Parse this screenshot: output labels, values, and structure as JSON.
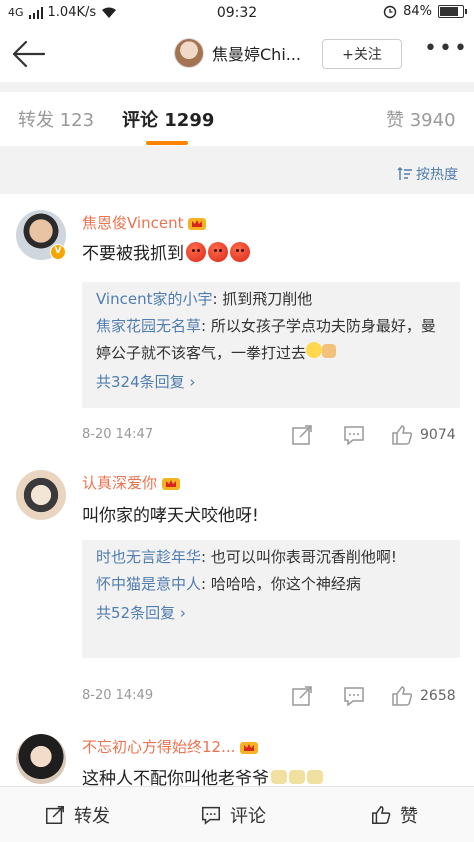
{
  "status_bar": {
    "signal_text": "4G",
    "speed": "1.04K/s",
    "time": "09:32",
    "battery": "84%",
    "battery_level": 0.84
  },
  "nav": {
    "title": "焦曼婷Chi...",
    "follow_label": "+关注",
    "more_label": "•••"
  },
  "tabs": [
    {
      "label": "转发 123",
      "active": false
    },
    {
      "label": "评论 1299",
      "active": true
    },
    {
      "label": "赞 3940",
      "active": false
    }
  ],
  "sort_label": "按热度",
  "comments": [
    {
      "name": "焦恩俊Vincent",
      "text": "不要被我抓到",
      "emojis": [
        "angry",
        "angry",
        "angry"
      ],
      "replies": [
        {
          "name": "Vincent家的小宇",
          "text": ": 抓到飛刀削他"
        },
        {
          "name": "焦家花园无名草",
          "text": ": 所以女孩子学点功夫防身最好，曼婷公子就不该客气，一拳打过去"
        }
      ],
      "more_replies": "共324条回复 ›",
      "time": "8-20 14:47",
      "likes": "9074"
    },
    {
      "name": "认真深爱你",
      "text": "叫你家的哮天犬咬他呀!",
      "replies": [
        {
          "name": "时也无言趁年华",
          "text": ": 也可以叫你表哥沉香削他啊!"
        },
        {
          "name": "怀中猫是意中人",
          "text": ": 哈哈哈，你这个神经病"
        }
      ],
      "more_replies": "共52条回复 ›",
      "time": "8-20 14:49",
      "likes": "2658"
    },
    {
      "name": "不忘初心方得始终12...",
      "text": "这种人不配你叫他老爷爷"
    }
  ],
  "bottom_bar": {
    "repost": "转发",
    "comment": "评论",
    "like": "赞"
  },
  "colors": {
    "accent": "#ff8200",
    "username": "#eb7350",
    "link": "#507daf"
  }
}
